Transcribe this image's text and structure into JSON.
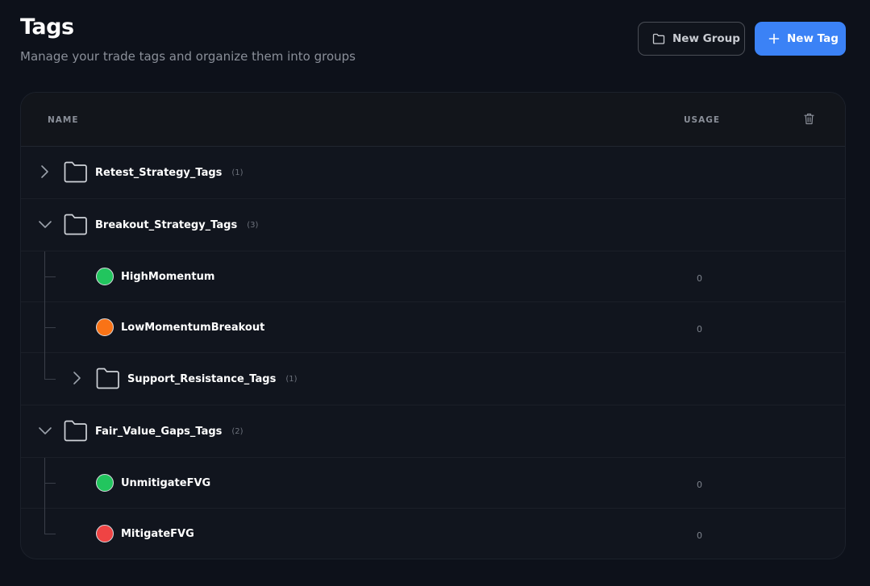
{
  "page": {
    "title": "Tags",
    "subtitle": "Manage your trade tags and organize them into groups"
  },
  "actions": {
    "new_group": "New Group",
    "new_tag": "New Tag"
  },
  "table": {
    "col_name": "NAME",
    "col_usage": "USAGE"
  },
  "rows": [
    {
      "kind": "folder",
      "name": "Retest_Strategy_Tags",
      "count": "(1)",
      "expanded": false
    },
    {
      "kind": "folder",
      "name": "Breakout_Strategy_Tags",
      "count": "(3)",
      "expanded": true
    },
    {
      "kind": "tag",
      "name": "HighMomentum",
      "color": "#22c55e",
      "usage": "0"
    },
    {
      "kind": "tag",
      "name": "LowMomentumBreakout",
      "color": "#f97316",
      "usage": "0"
    },
    {
      "kind": "folder",
      "name": "Support_Resistance_Tags",
      "count": "(1)",
      "expanded": false
    },
    {
      "kind": "folder",
      "name": "Fair_Value_Gaps_Tags",
      "count": "(2)",
      "expanded": true
    },
    {
      "kind": "tag",
      "name": "UnmitigateFVG",
      "color": "#22c55e",
      "usage": "0"
    },
    {
      "kind": "tag",
      "name": "MitigateFVG",
      "color": "#ef4444",
      "usage": "0"
    }
  ],
  "colors": {
    "accent": "#3b82f6",
    "background": "#0d111a"
  }
}
